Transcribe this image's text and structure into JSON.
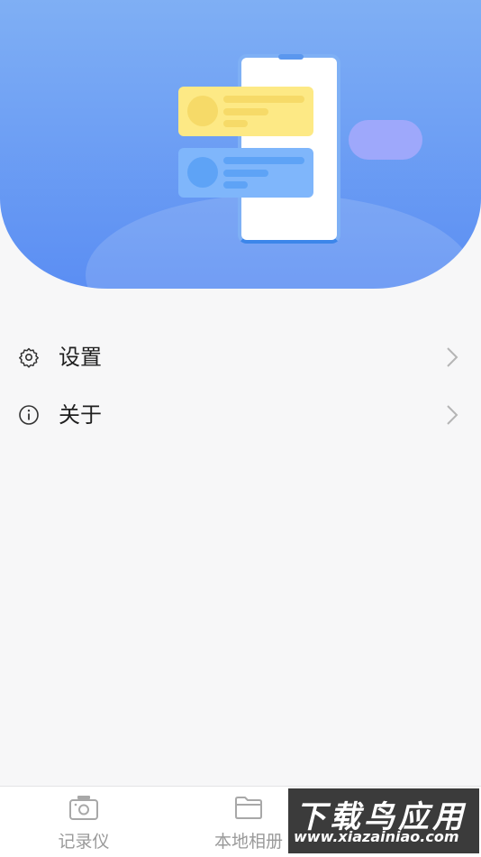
{
  "menu": {
    "items": [
      {
        "label": "设置",
        "icon": "gear-icon"
      },
      {
        "label": "关于",
        "icon": "info-icon"
      }
    ]
  },
  "tabbar": {
    "tabs": [
      {
        "label": "记录仪",
        "icon": "camera-icon"
      },
      {
        "label": "本地相册",
        "icon": "folder-icon"
      }
    ]
  },
  "watermark": {
    "title": "下载鸟应用",
    "subtitle": "www.xiazainiao.com"
  },
  "colors": {
    "hero_top": "#7faff4",
    "hero_bottom": "#5b8ef3",
    "background": "#f7f7f8",
    "text": "#1f1f1f",
    "tab_text": "#9a9a9a"
  }
}
